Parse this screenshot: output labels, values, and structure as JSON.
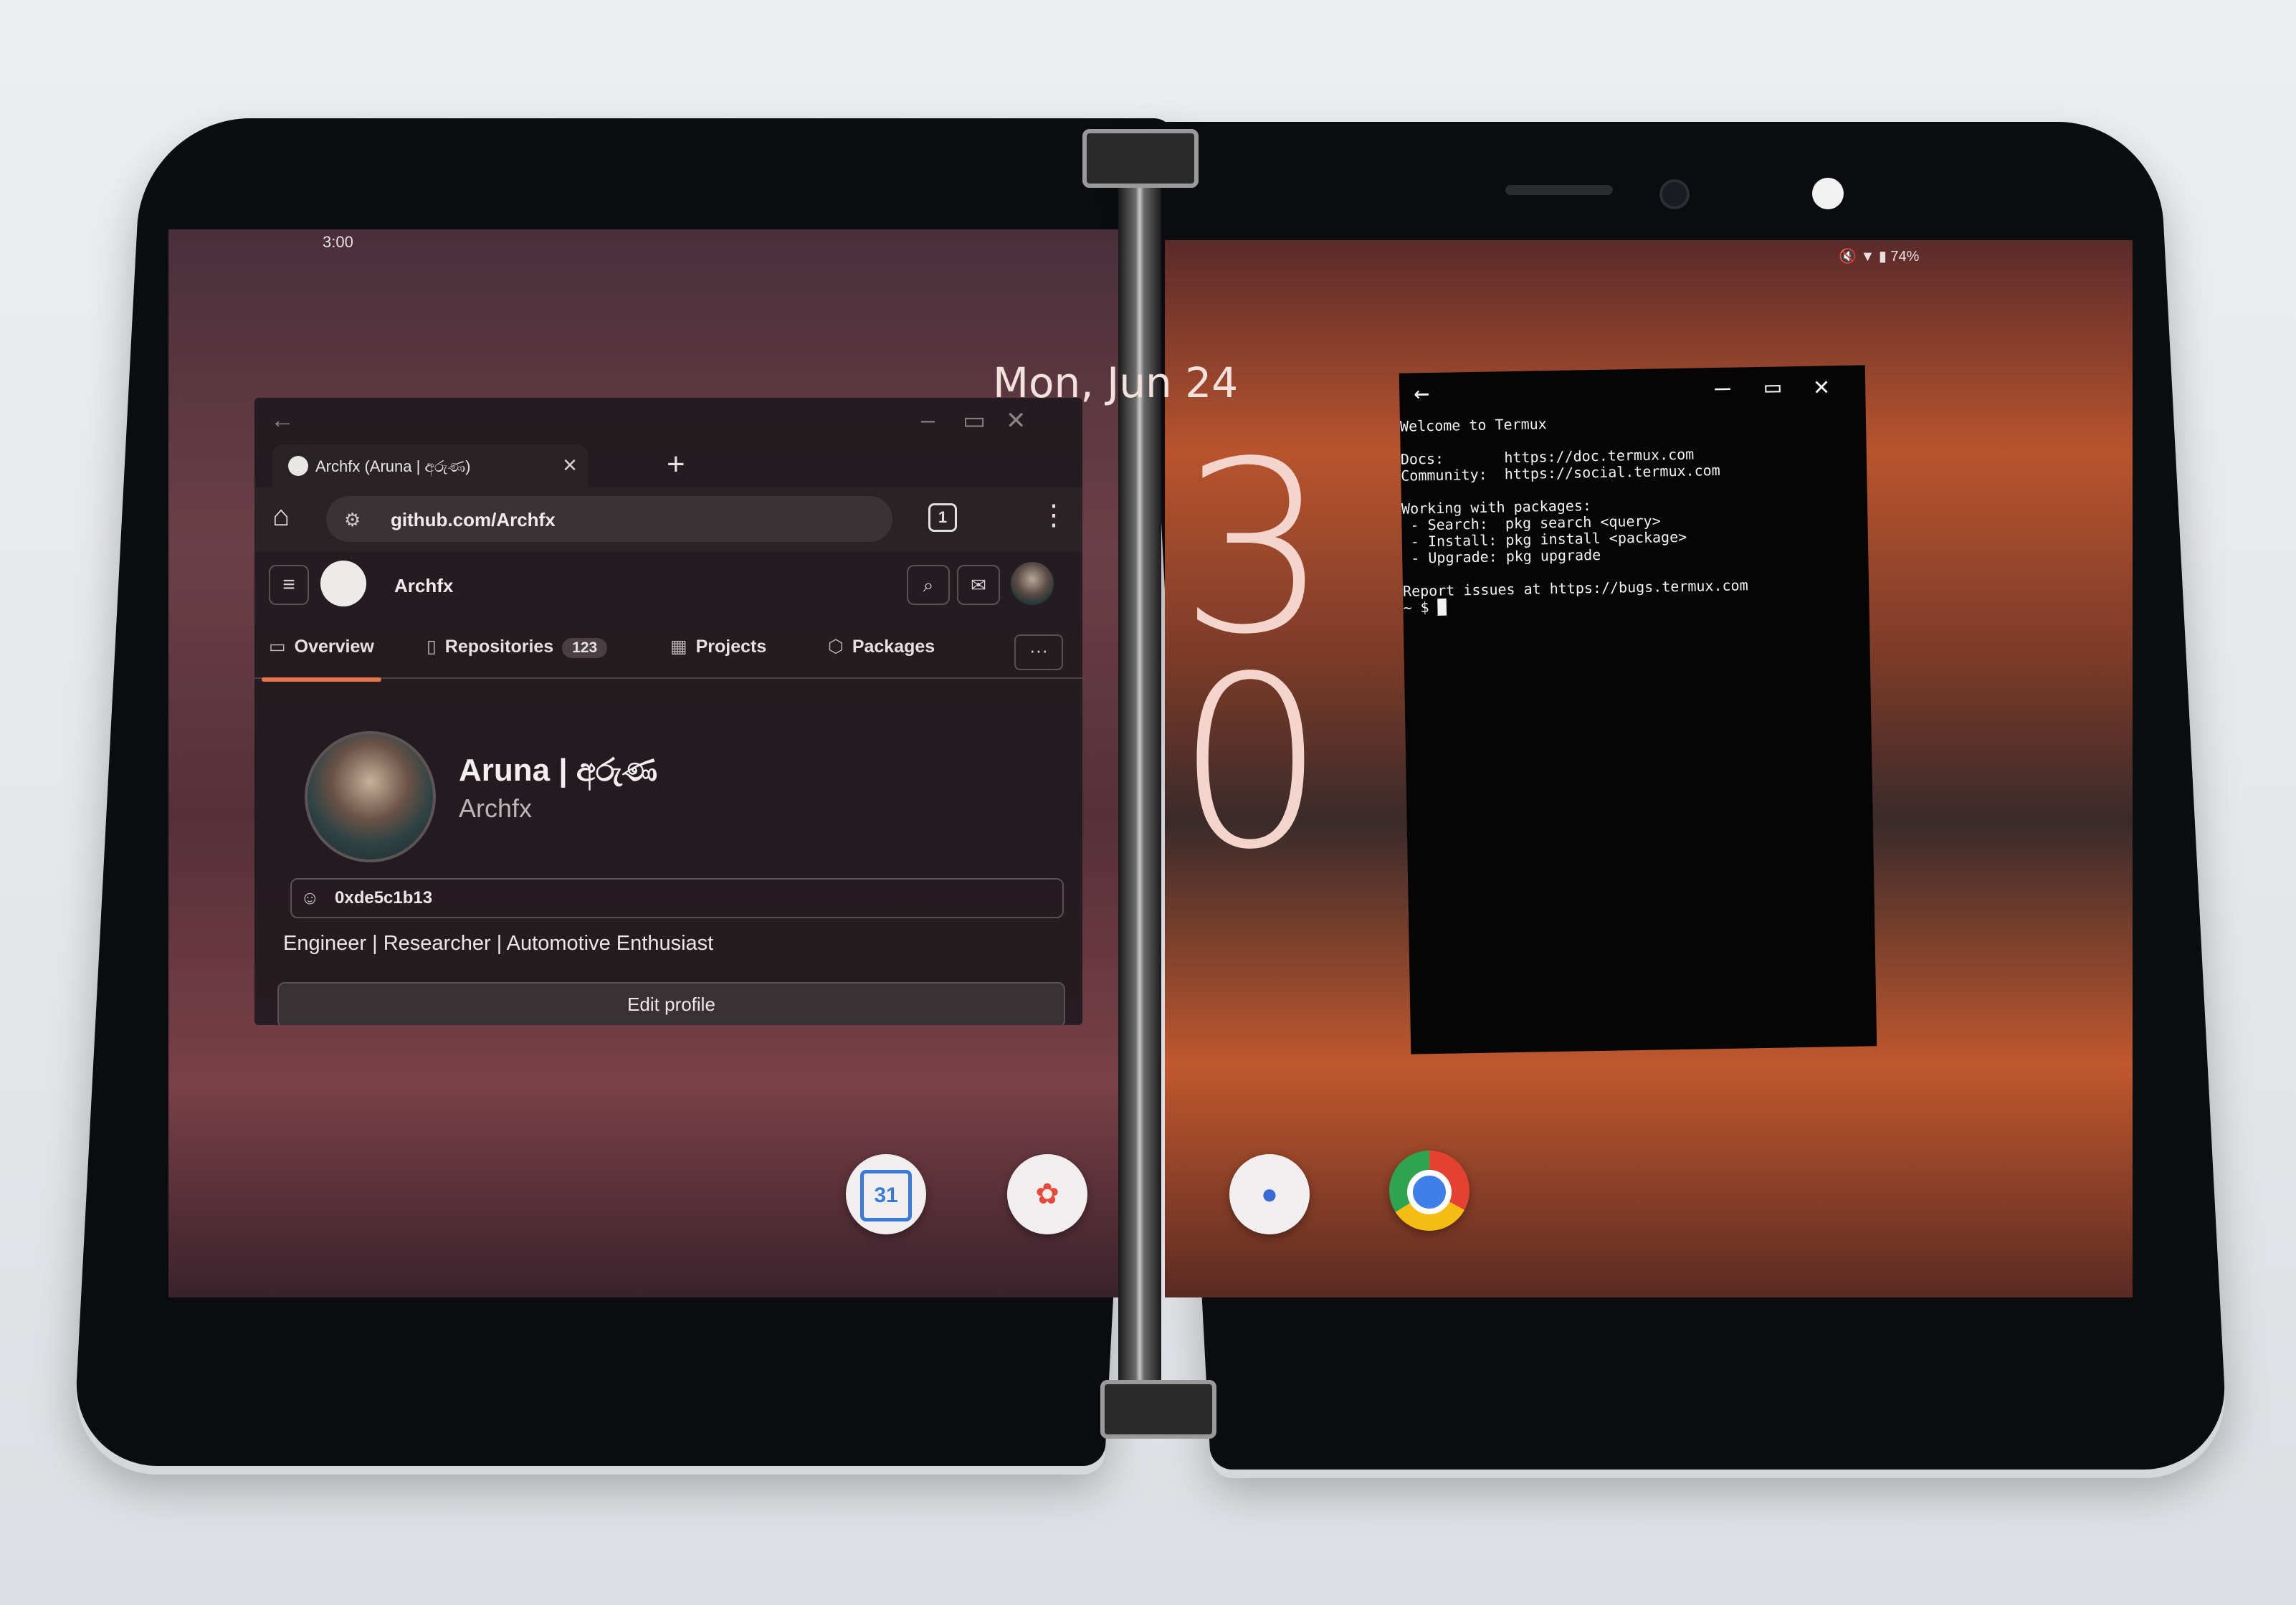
{
  "status_bar": {
    "time": "3:00",
    "battery": "74%"
  },
  "lockscreen": {
    "date": "Mon, Jun 24",
    "hour_digit": "3",
    "minute_digit": "0"
  },
  "browser": {
    "tab_title": "Archfx (Aruna | අරුණ)",
    "url": "github.com/Archfx",
    "tab_count": "1",
    "new_tab": "+",
    "close_tab": "×",
    "header_name": "Archfx",
    "nav": {
      "overview": "Overview",
      "repositories": "Repositories",
      "repositories_count": "123",
      "projects": "Projects",
      "packages": "Packages"
    },
    "more": "···",
    "profile": {
      "name": "Aruna | අරුණ",
      "login": "Archfx",
      "status": "0xde5c1b13",
      "bio": "Engineer | Researcher | Automotive Enthusiast",
      "edit_button": "Edit profile"
    },
    "icons": {
      "back": "back-arrow-icon",
      "minimize": "minimize-icon",
      "maximize": "maximize-icon",
      "close": "close-icon",
      "home": "home-icon",
      "site_settings": "site-settings-icon",
      "menu": "more-vertical-icon",
      "search": "search-icon",
      "inbox": "inbox-icon"
    }
  },
  "termux": {
    "lines": [
      "Welcome to Termux",
      "",
      "Docs:       https://doc.termux.com",
      "Community:  https://social.termux.com",
      "",
      "Working with packages:",
      " - Search:  pkg search <query>",
      " - Install: pkg install <package>",
      " - Upgrade: pkg upgrade",
      "",
      "Report issues at https://bugs.termux.com",
      "~ $ █"
    ]
  },
  "dock": {
    "calendar_day": "31",
    "apps": [
      "calendar-icon",
      "photos-icon",
      "contacts-icon",
      "chrome-icon"
    ]
  },
  "colors": {
    "accent": "#e8744b",
    "terminal_bg": "#050505"
  }
}
